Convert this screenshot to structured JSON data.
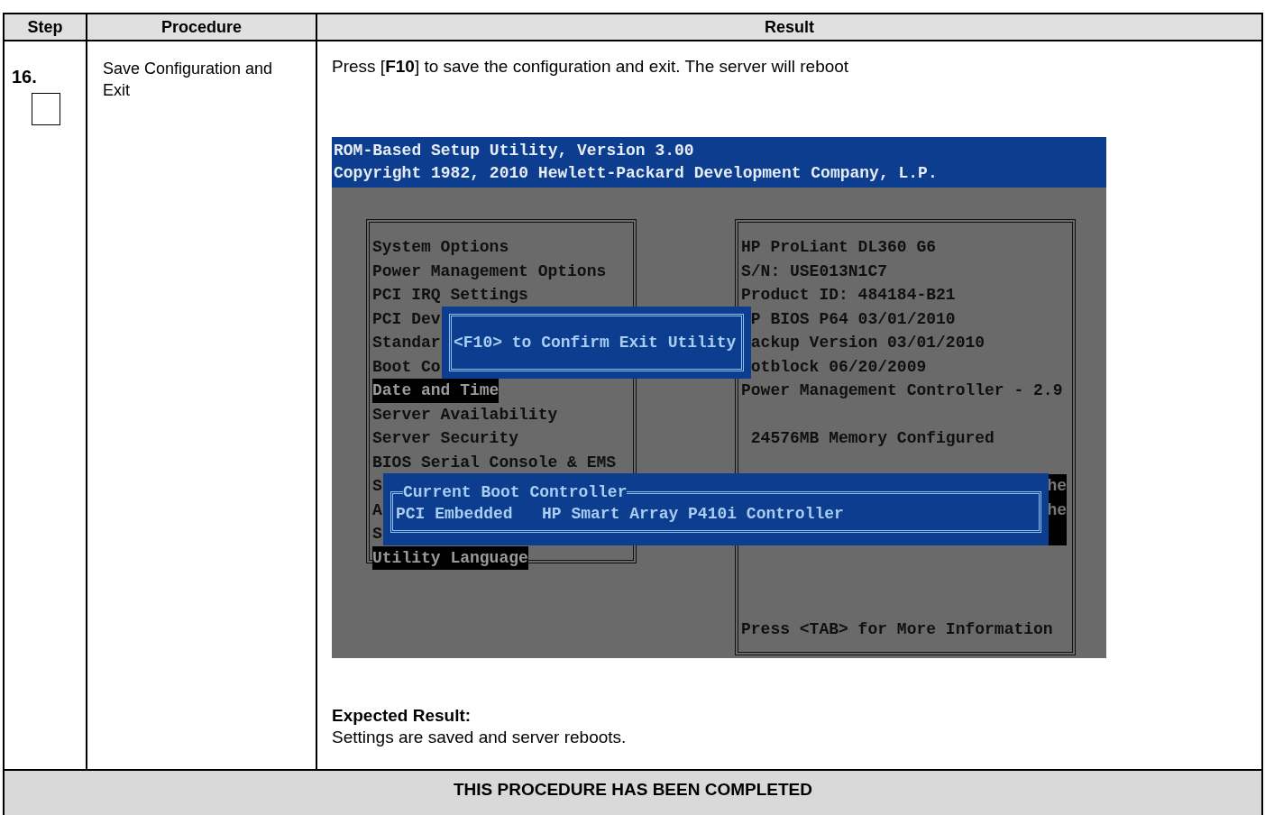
{
  "header": {
    "columns": [
      "Step",
      "Procedure",
      "Result"
    ]
  },
  "step": {
    "number": "16.",
    "checked": false,
    "procedure": "Save Configuration and Exit",
    "instruction": "Press [**F10**] to save the configuration and exit. The server will reboot",
    "bios_screen": {
      "title_lines": [
        "ROM-Based Setup Utility, Version 3.00",
        "Copyright 1982, 2010 Hewlett-Packard Development Company, L.P."
      ],
      "menu_items": [
        {
          "label": "System Options",
          "highlighted": false
        },
        {
          "label": "Power Management Options",
          "highlighted": false
        },
        {
          "label": "PCI IRQ Settings",
          "highlighted": false
        },
        {
          "label": "PCI Dev",
          "highlighted": false
        },
        {
          "label": "Standar",
          "highlighted": false
        },
        {
          "label": "Boot Co",
          "highlighted": false
        },
        {
          "label": "Date and Time",
          "highlighted": true
        },
        {
          "label": "Server Availability",
          "highlighted": false
        },
        {
          "label": "Server Security",
          "highlighted": false
        },
        {
          "label": "BIOS Serial Console & EMS",
          "highlighted": false
        },
        {
          "label": "S",
          "highlighted": false
        },
        {
          "label": "A",
          "highlighted": false
        },
        {
          "label": "S",
          "highlighted": false
        },
        {
          "label": "Utility Language",
          "highlighted": true
        }
      ],
      "info_lines": [
        {
          "text": "HP ProLiant DL360 G6",
          "covered": false
        },
        {
          "text": "S/N: USE013N1C7",
          "covered": false
        },
        {
          "text": "Product ID: 484184-B21",
          "covered": false
        },
        {
          "text": "P BIOS P64 03/01/2010",
          "covered": true
        },
        {
          "text": "ackup Version 03/01/2010",
          "covered": true
        },
        {
          "text": "otblock 06/20/2009",
          "covered": true
        },
        {
          "text": "Power Management Controller - 2.9",
          "covered": false
        }
      ],
      "memory": "24576MB Memory Configured",
      "tails": [
        "he",
        "he"
      ],
      "hint": "Press <TAB> for More Information",
      "confirm_dialog": {
        "text": "<F10> to Confirm Exit Utility"
      },
      "boot_dialog": {
        "title": "Current Boot Controller",
        "text": "PCI Embedded   HP Smart Array P410i Controller"
      }
    },
    "expected_label": "Expected Result:",
    "expected_text": "Settings are saved and server reboots."
  },
  "footer": "THIS PROCEDURE HAS BEEN COMPLETED"
}
